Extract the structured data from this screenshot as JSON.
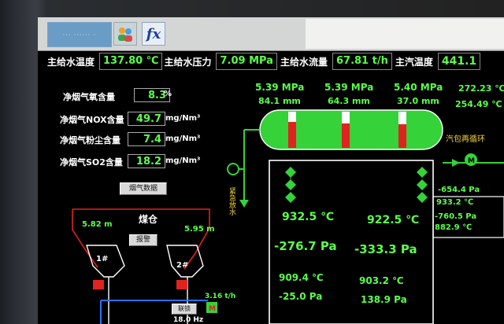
{
  "toolbar": {
    "logo_text": "··· ······ ·",
    "user_icon": "users-icon",
    "calc_icon": "calculator-icon",
    "calc_glyph": "fx"
  },
  "header": {
    "items": [
      {
        "label": "主给水温度",
        "value": "137.80 ℃"
      },
      {
        "label": "主给水压力",
        "value": "7.09 MPa"
      },
      {
        "label": "主给水流量",
        "value": "67.81 t/h"
      },
      {
        "label": "主汽温度",
        "value": "441.1"
      }
    ]
  },
  "gas": {
    "rows": [
      {
        "label": "净烟气氧含量",
        "value": "8.3",
        "unit": "%"
      },
      {
        "label": "净烟气NOX含量",
        "value": "49.7",
        "unit": "mg/Nm³"
      },
      {
        "label": "净烟气粉尘含量",
        "value": "7.4",
        "unit": "mg/Nm³"
      },
      {
        "label": "净烟气SO2含量",
        "value": "18.2",
        "unit": "mg/Nm³"
      }
    ],
    "button": "烟气数据"
  },
  "drum": {
    "top": [
      {
        "pressure": "5.39 MPa",
        "level": "84.1 mm"
      },
      {
        "pressure": "5.39 MPa",
        "level": "64.3 mm"
      },
      {
        "pressure": "5.40 MPa",
        "level": "37.0 mm"
      }
    ],
    "right_top": [
      "272.23 ℃",
      "254.49 ℃"
    ],
    "recirc_label": "汽包再循环",
    "emergency_label": "紧急放水",
    "levels": [
      0.72,
      0.68,
      0.66
    ]
  },
  "coal": {
    "title": "煤仓",
    "left": "5.82 m",
    "right": "5.95 m",
    "button": "报警",
    "hopper1": "1#",
    "hopper2": "2#",
    "flow": "3.16 t/h",
    "feeder_button": "联锁",
    "freq": "18.0 Hz"
  },
  "furnace": {
    "t_left": "932.5 ℃",
    "t_right": "922.5 ℃",
    "p_left": "-276.7 Pa",
    "p_right": "-333.3 Pa",
    "t2_left": "909.4 ℃",
    "t2_right": "903.2 ℃",
    "p2_left": "-25.0 Pa",
    "p2_right": "138.9 Pa"
  },
  "side": {
    "v1": "-654.4 Pa",
    "v2": "933.2 ℃",
    "v3": "-760.5 Pa",
    "v4": "882.9 ℃"
  },
  "colors": {
    "green": "#5bff4a",
    "drum_green": "#35d23a",
    "red": "#e0231f",
    "yellow": "#f5d33a"
  }
}
